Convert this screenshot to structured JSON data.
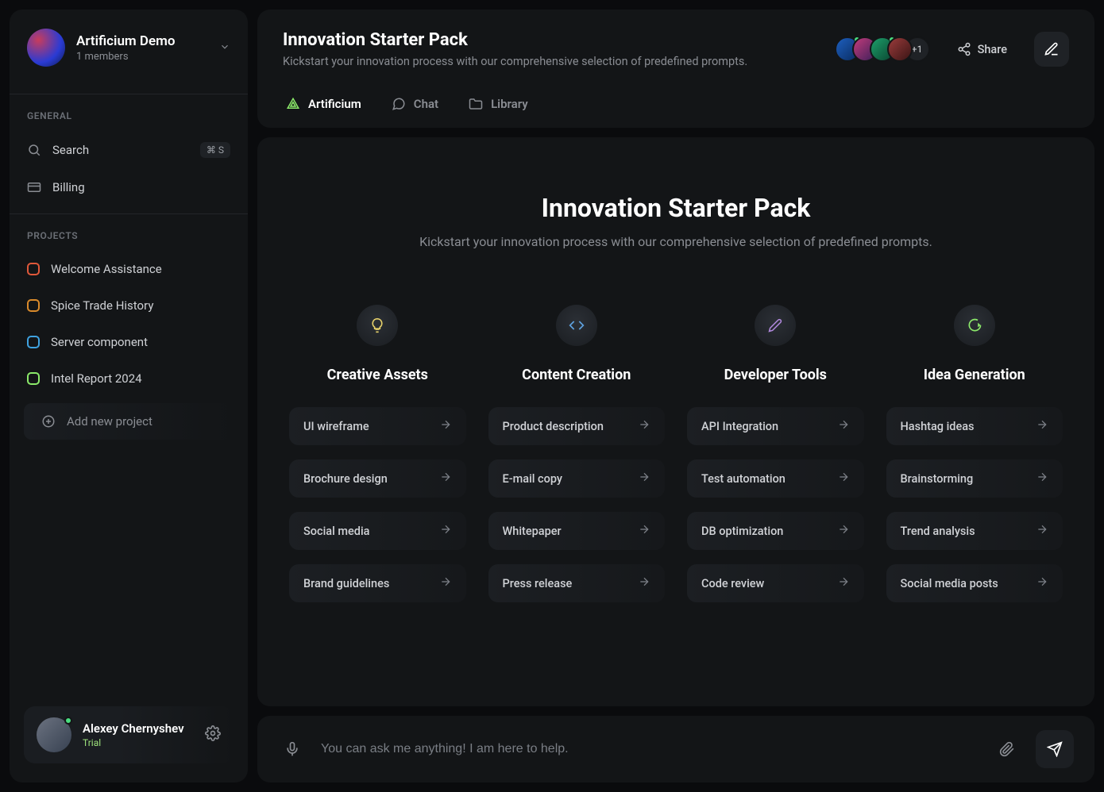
{
  "workspace": {
    "name": "Artificium Demo",
    "members": "1 members"
  },
  "sidebar": {
    "general_label": "GENERAL",
    "search_label": "Search",
    "search_shortcut": "⌘ S",
    "billing_label": "Billing",
    "projects_label": "PROJECTS",
    "projects": [
      {
        "label": "Welcome Assistance",
        "color": "#e0583a"
      },
      {
        "label": "Spice Trade History",
        "color": "#d98a2b"
      },
      {
        "label": "Server component",
        "color": "#3fa2e0"
      },
      {
        "label": "Intel Report 2024",
        "color": "#8be96a"
      }
    ],
    "add_project": "Add new project"
  },
  "user": {
    "name": "Alexey Chernyshev",
    "plan": "Trial"
  },
  "header": {
    "title": "Innovation Starter Pack",
    "subtitle": "Kickstart your innovation process with our comprehensive selection of predefined prompts.",
    "share": "Share",
    "overflow": "+1",
    "avatar_count": 4,
    "avatars": [
      {
        "bg": "linear-gradient(135deg,#1d5fbf,#0a2b5e)",
        "online": true
      },
      {
        "bg": "linear-gradient(135deg,#c23b7a,#3b1f5a)",
        "online": false
      },
      {
        "bg": "linear-gradient(135deg,#1d9f6a,#0a4530)",
        "online": true
      },
      {
        "bg": "linear-gradient(135deg,#9a3b3b,#3a1515)",
        "online": false
      }
    ]
  },
  "tabs": [
    {
      "label": "Artificium",
      "active": true
    },
    {
      "label": "Chat",
      "active": false
    },
    {
      "label": "Library",
      "active": false
    }
  ],
  "hero": {
    "title": "Innovation Starter Pack",
    "subtitle": "Kickstart your innovation process with our comprehensive selection of predefined prompts."
  },
  "columns": [
    {
      "title": "Creative Assets",
      "icon": "bulb",
      "icon_color": "#e7d16a",
      "items": [
        "UI wireframe",
        "Brochure design",
        "Social media",
        "Brand guidelines"
      ]
    },
    {
      "title": "Content Creation",
      "icon": "code",
      "icon_color": "#5fa2e0",
      "items": [
        "Product description",
        "E-mail copy",
        "Whitepaper",
        "Press release"
      ]
    },
    {
      "title": "Developer Tools",
      "icon": "pencil",
      "icon_color": "#b38ae0",
      "items": [
        "API Integration",
        "Test automation",
        "DB optimization",
        "Code review"
      ]
    },
    {
      "title": "Idea Generation",
      "icon": "chat-bubble",
      "icon_color": "#8be96a",
      "items": [
        "Hashtag ideas",
        "Brainstorming",
        "Trend analysis",
        "Social media posts"
      ]
    }
  ],
  "chat": {
    "placeholder": "You can ask me anything! I am here to help."
  }
}
